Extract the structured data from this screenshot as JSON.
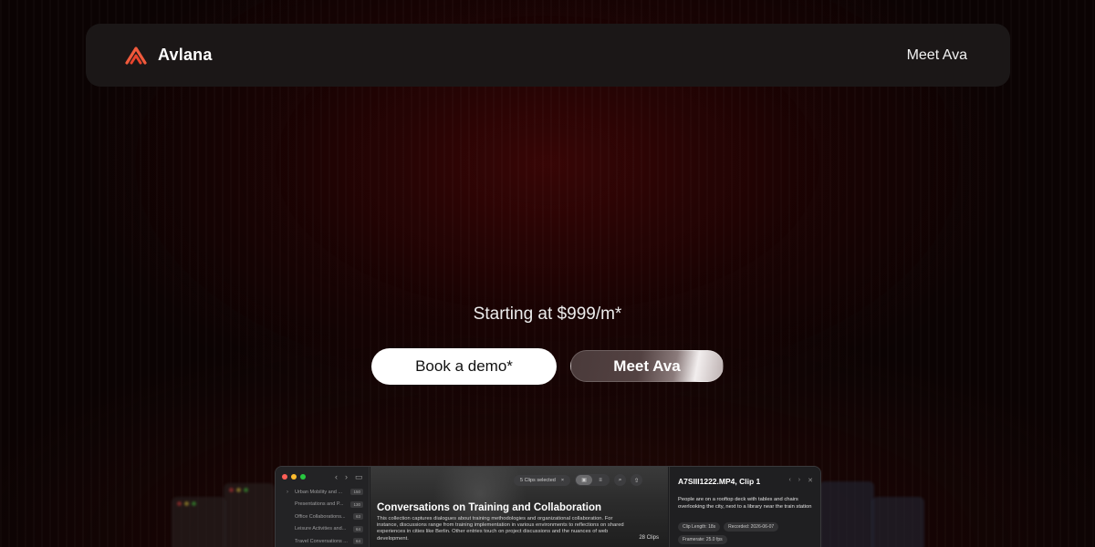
{
  "nav": {
    "brand_name": "Avlana",
    "link_label": "Meet Ava",
    "logo_color": "#f05a3c"
  },
  "hero": {
    "price_text": "Starting at $999/m*",
    "primary_cta": "Book a demo*",
    "secondary_cta": "Meet Ava"
  },
  "app_preview": {
    "sidebar_items": [
      {
        "label": "Urban Mobility and ...",
        "count": "150",
        "icon": "chevron-right-icon"
      },
      {
        "label": "Presentations and P...",
        "count": "130"
      },
      {
        "label": "Office Collaborations...",
        "count": "63"
      },
      {
        "label": "Leisure Activities and...",
        "count": "64"
      },
      {
        "label": "Travel Conversations ...",
        "count": "64"
      }
    ],
    "toolbar": {
      "selection_text": "5 Clips selected",
      "selection_close": "×"
    },
    "collection_title": "Conversations on Training and Collaboration",
    "collection_description": "This collection captures dialogues about training methodologies and organizational collaboration. For instance, discussions range from training implementation in various environments to reflections on shared experiences in cities like Berlin. Other entries touch on project discussions and the nuances of web development.",
    "clip_count": "28 Clips",
    "detail": {
      "title": "A7SIII1222.MP4, Clip 1",
      "description": "People are on a rooftop deck with tables and chairs overlooking the city, next to a library near the train station",
      "tags": [
        "Clip Length: 18s",
        "Recorded: 2026-06-07",
        "Framerate: 25.0 fps"
      ]
    }
  }
}
